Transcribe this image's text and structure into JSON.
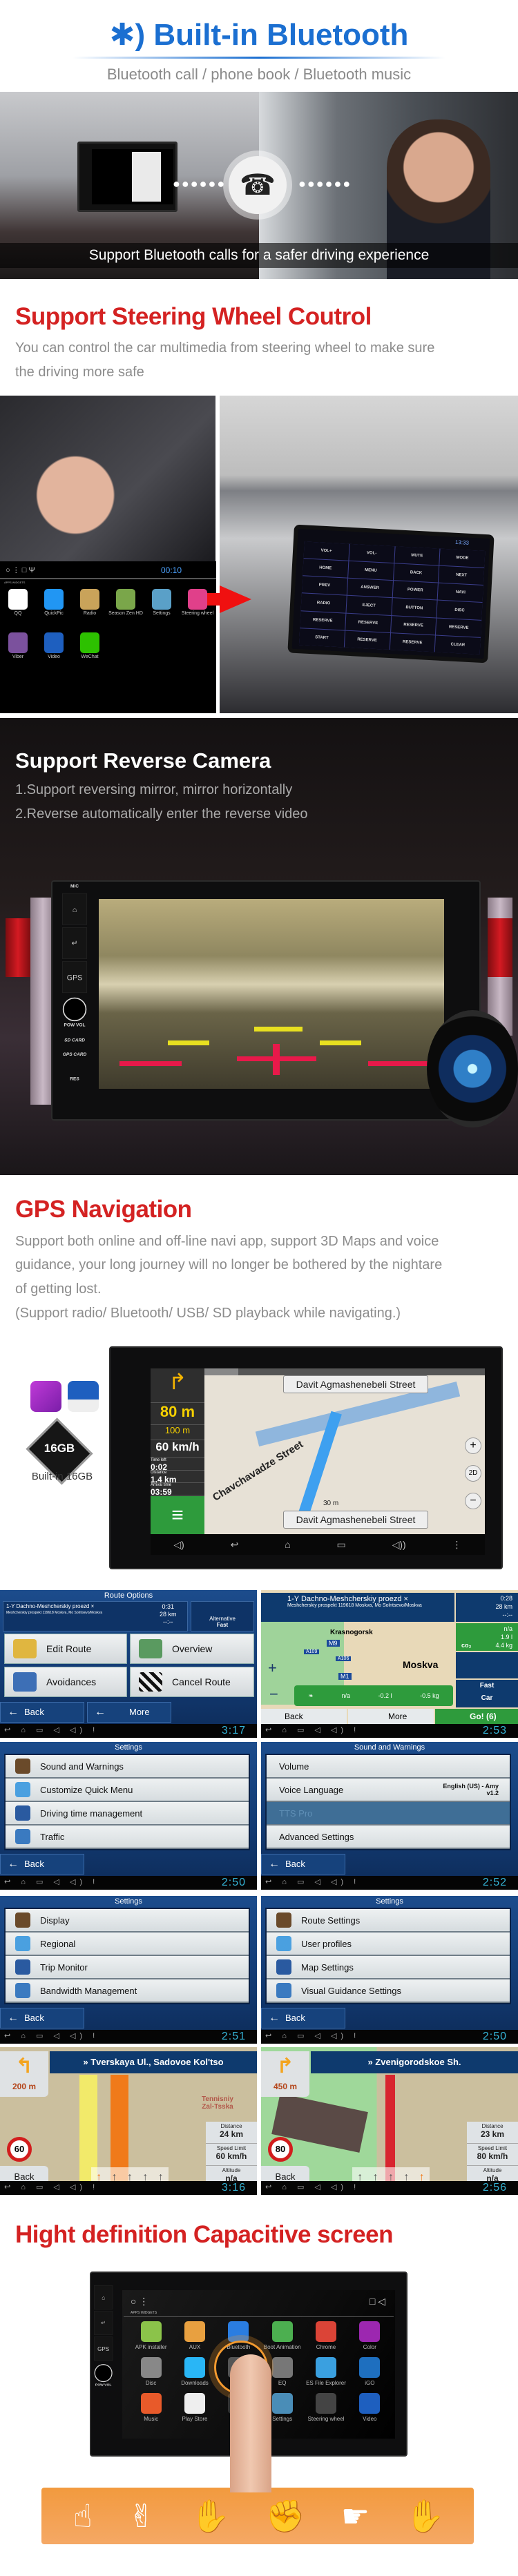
{
  "colors": {
    "accent_blue": "#1b6fd1",
    "accent_red": "#d42222",
    "gesture_orange": "#f29a3e"
  },
  "bluetooth": {
    "icon": "bluetooth-icon",
    "title": "Built-in Bluetooth",
    "subtitle": "Bluetooth call / phone book / Bluetooth music",
    "caption": "Support Bluetooth calls for a safer driving experience",
    "phone_icon": "phone-call-icon",
    "dots": "●●●●●●"
  },
  "steering": {
    "title": "Support Steering Wheel Coutrol",
    "desc_line1": "You can control the car multimedia from steering wheel to make sure",
    "desc_line2": "the driving more safe",
    "launcher": {
      "time": "00:10",
      "status_icons": "○  ⋮  □  Ψ",
      "tabs": "APPS    WIDGETS",
      "apps": [
        {
          "label": "QQ",
          "color": "#ffffff"
        },
        {
          "label": "QuickPic",
          "color": "#2196f3"
        },
        {
          "label": "Radio",
          "color": "#c9a35a"
        },
        {
          "label": "Season Zen HD",
          "color": "#7aa64a"
        },
        {
          "label": "Settings",
          "color": "#5aa0c8"
        },
        {
          "label": "Steering wheel",
          "color": "#e0408a"
        },
        {
          "label": "Viber",
          "color": "#7b519d"
        },
        {
          "label": "Video",
          "color": "#1e5fbf"
        },
        {
          "label": "WeChat",
          "color": "#2dc100"
        }
      ]
    },
    "key_screen": {
      "time": "13:33",
      "keys": [
        "VOL+",
        "VOL-",
        "MUTE",
        "MODE",
        "HOME",
        "MENU",
        "BACK",
        "NEXT",
        "PREV",
        "ANSWER",
        "POWER",
        "NAVI",
        "RADIO",
        "EJECT",
        "BUTTON",
        "DISC",
        "RESERVE",
        "RESERVE",
        "RESERVE",
        "RESERVE",
        "START",
        "RESERVE",
        "RESERVE",
        "CLEAR"
      ]
    }
  },
  "reverse": {
    "title": "Support Reverse Camera",
    "line1": "1.Support reversing mirror, mirror horizontally",
    "line2": "2.Reverse automatically enter the reverse video"
  },
  "head_unit": {
    "mic": "MIC",
    "home": "⌂",
    "back": "↵",
    "gps": "GPS",
    "pow_vol": "POW  VOL",
    "sd": "SD CARD",
    "gps_card": "GPS CARD",
    "res": "RES"
  },
  "gps": {
    "title": "GPS Navigation",
    "line1": "Support both online and off-line navi app, support 3D Maps and voice",
    "line2": "guidance, your long journey will no longer be bothered by the nightare",
    "line3": "of getting lost.",
    "line4": "(Support radio/ Bluetooth/ USB/ SD playback while navigating.)",
    "chip_label": "16GB",
    "builtin": "Built-in 16GB",
    "nav": {
      "street_top": "Davit Agmashenebeli Street",
      "street_bottom": "Davit Agmashenebeli Street",
      "side_street": "Chavchavadze Street",
      "dist1": "80 m",
      "dist2": "100 m",
      "speed": "60 km/h",
      "time_left_label": "Time left",
      "time_left": "0:02",
      "distance_label": "Distance",
      "distance": "1.4 km",
      "arrival_label": "Arrival time",
      "arrival": "03:59",
      "scale": "30 m",
      "mode_2d": "2D",
      "navbar": [
        "◁)",
        "↩",
        "⌂",
        "▭",
        "◁))",
        "⋮"
      ]
    }
  },
  "screens": {
    "status_left": "↩ ⌂ ▭ ◁ ◁) !",
    "route_options": {
      "title": "Route Options",
      "dest": "1-Y Dachno-Meshcherskiy proezd ×",
      "address": "Meshcherskiy prospekt 119618 Moskva, Mo Solntsevo/Moskva",
      "time": "0:31",
      "dist": "28 km",
      "eta": "--:--",
      "alt1": "Alternative",
      "alt2": "Fast",
      "buttons": [
        "Edit Route",
        "Overview",
        "Avoidances",
        "Cancel Route"
      ],
      "back": "Back",
      "more": "More",
      "clock": "3:17"
    },
    "route_map": {
      "dest": "1-Y Dachno-Meshcherskiy proezd ×",
      "address": "Meshcherskiy prospekt 119618 Moskva, Mo Solntsevo/Moskva",
      "time": "0:28",
      "dist": "28 km",
      "eta": "--:--",
      "eco": [
        "n/a",
        "1.9 l",
        "4.4 kg"
      ],
      "co2": "co₂",
      "city1": "Krasnogorsk",
      "city2": "Moskva",
      "roads": [
        "M9",
        "A109",
        "A106",
        "M1"
      ],
      "delta": [
        "n/a",
        "-0.2 l",
        "-0.5 kg"
      ],
      "mode": "Fast",
      "vehicle": "Car",
      "back": "Back",
      "more": "More",
      "go": "Go! (6)",
      "clock": "2:53"
    },
    "settings1": {
      "title": "Settings",
      "items": [
        "Sound and Warnings",
        "Customize Quick Menu",
        "Driving time management",
        "Traffic"
      ],
      "back": "Back",
      "clock": "2:50"
    },
    "sound": {
      "title": "Sound and Warnings",
      "items": [
        "Volume",
        "Voice Language",
        "TTS Pro",
        "Advanced Settings"
      ],
      "voice_value1": "English (US) - Amy",
      "voice_value2": "v1.2",
      "back": "Back",
      "clock": "2:52"
    },
    "settings2": {
      "title": "Settings",
      "items": [
        "Display",
        "Regional",
        "Trip Monitor",
        "Bandwidth Management"
      ],
      "back": "Back",
      "clock": "2:51"
    },
    "settings3": {
      "title": "Settings",
      "items": [
        "Route Settings",
        "User profiles",
        "Map Settings",
        "Visual Guidance Settings"
      ],
      "back": "Back",
      "clock": "2:50"
    },
    "drive1": {
      "street": "» Tverskaya Ul., Sadovoe Kol'tso",
      "turn": "200 m",
      "poi": "Tennisniy Zal-Tsska",
      "limit": "60",
      "distance_label": "Distance",
      "distance": "24 km",
      "speed_label": "Speed Limit",
      "speed": "60 km/h",
      "alt_label": "Altitude",
      "alt": "n/a",
      "back": "Back",
      "clock": "3:16"
    },
    "drive2": {
      "street": "» Zvenigorodskoe Sh.",
      "turn": "450 m",
      "limit": "80",
      "distance_label": "Distance",
      "distance": "23 km",
      "speed_label": "Speed Limit",
      "speed": "80 km/h",
      "alt_label": "Altitude",
      "alt": "n/a",
      "back": "Back",
      "clock": "2:56"
    }
  },
  "capacitive": {
    "title": "Hight definition Capacitive screen",
    "tabs": "APPS   WIDGETS",
    "apps": [
      {
        "label": "APK installer",
        "color": "#8bc34a"
      },
      {
        "label": "AUX",
        "color": "#e8a040"
      },
      {
        "label": "Bluetooth",
        "color": "#2a7de1"
      },
      {
        "label": "Boot Animation",
        "color": "#4caf50"
      },
      {
        "label": "Chrome",
        "color": "#db4437"
      },
      {
        "label": "Color",
        "color": "#9c27b0"
      },
      {
        "label": "Disc",
        "color": "#888888"
      },
      {
        "label": "Downloads",
        "color": "#29b6f6"
      },
      {
        "label": "",
        "color": "#555555"
      },
      {
        "label": "EQ",
        "color": "#777777"
      },
      {
        "label": "ES File Explorer",
        "color": "#3aa0e0"
      },
      {
        "label": "iGO",
        "color": "#1e6fbf"
      },
      {
        "label": "Music",
        "color": "#e85a2a"
      },
      {
        "label": "Play Store",
        "color": "#eeeeee"
      },
      {
        "label": "",
        "color": "#333333"
      },
      {
        "label": "Settings",
        "color": "#4a8db7"
      },
      {
        "label": "Steering wheel",
        "color": "#444444"
      },
      {
        "label": "Video",
        "color": "#1e5fbf"
      }
    ],
    "gestures": [
      "tap-gesture-icon",
      "double-tap-gesture-icon",
      "pinch-gesture-icon",
      "rotate-gesture-icon",
      "swipe-gesture-icon",
      "palm-gesture-icon"
    ],
    "gesture_glyphs": [
      "☝",
      "✌",
      "✋",
      "✊",
      "☛",
      "✋"
    ]
  }
}
